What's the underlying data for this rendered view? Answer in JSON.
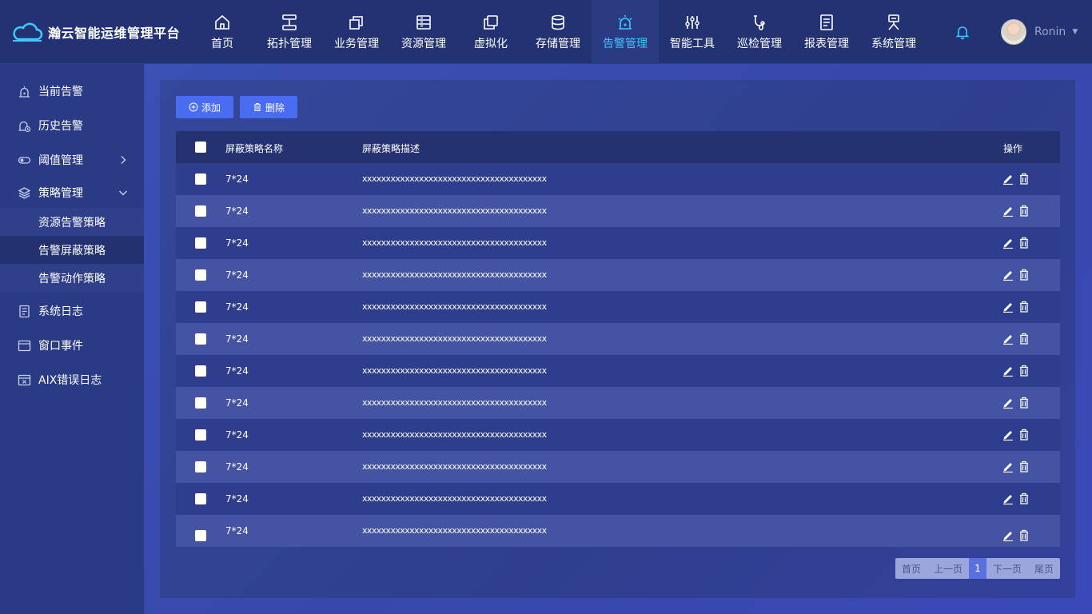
{
  "brand": {
    "name": "瀚云智能运维管理平台"
  },
  "nav": [
    {
      "label": "首页",
      "icon": "home-icon"
    },
    {
      "label": "拓扑管理",
      "icon": "topology-icon"
    },
    {
      "label": "业务管理",
      "icon": "business-icon"
    },
    {
      "label": "资源管理",
      "icon": "resource-icon"
    },
    {
      "label": "虚拟化",
      "icon": "virtualization-icon"
    },
    {
      "label": "存储管理",
      "icon": "storage-icon"
    },
    {
      "label": "告警管理",
      "icon": "alarm-icon",
      "active": true
    },
    {
      "label": "智能工具",
      "icon": "tools-icon"
    },
    {
      "label": "巡检管理",
      "icon": "inspection-icon"
    },
    {
      "label": "报表管理",
      "icon": "report-icon"
    },
    {
      "label": "系统管理",
      "icon": "system-icon"
    }
  ],
  "header": {
    "username": "Ronin",
    "accent": "#3ec8ff"
  },
  "sidebar": {
    "items": [
      {
        "label": "当前告警",
        "icon": "current-alarm-icon"
      },
      {
        "label": "历史告警",
        "icon": "history-alarm-icon"
      },
      {
        "label": "阈值管理",
        "icon": "threshold-icon"
      },
      {
        "label": "策略管理",
        "icon": "strategy-icon",
        "expanded": true
      },
      {
        "label": "系统日志",
        "icon": "system-log-icon"
      },
      {
        "label": "窗口事件",
        "icon": "window-event-icon"
      },
      {
        "label": "AIX错误日志",
        "icon": "aix-error-log-icon"
      }
    ],
    "submenu": [
      {
        "label": "资源告警策略"
      },
      {
        "label": "告警屏蔽策略",
        "active": true
      },
      {
        "label": "告警动作策略"
      }
    ]
  },
  "toolbar": {
    "add_label": "添加",
    "delete_label": "删除",
    "button_color": "#4a6cf0"
  },
  "table": {
    "headers": {
      "name": "屏蔽策略名称",
      "desc": "屏蔽策略描述",
      "op": "操作"
    },
    "rows": [
      {
        "name": "7*24",
        "desc": "xxxxxxxxxxxxxxxxxxxxxxxxxxxxxxxxxxxxxxx"
      },
      {
        "name": "7*24",
        "desc": "xxxxxxxxxxxxxxxxxxxxxxxxxxxxxxxxxxxxxxx"
      },
      {
        "name": "7*24",
        "desc": "xxxxxxxxxxxxxxxxxxxxxxxxxxxxxxxxxxxxxxx"
      },
      {
        "name": "7*24",
        "desc": "xxxxxxxxxxxxxxxxxxxxxxxxxxxxxxxxxxxxxxx"
      },
      {
        "name": "7*24",
        "desc": "xxxxxxxxxxxxxxxxxxxxxxxxxxxxxxxxxxxxxxx"
      },
      {
        "name": "7*24",
        "desc": "xxxxxxxxxxxxxxxxxxxxxxxxxxxxxxxxxxxxxxx"
      },
      {
        "name": "7*24",
        "desc": "xxxxxxxxxxxxxxxxxxxxxxxxxxxxxxxxxxxxxxx"
      },
      {
        "name": "7*24",
        "desc": "xxxxxxxxxxxxxxxxxxxxxxxxxxxxxxxxxxxxxxx"
      },
      {
        "name": "7*24",
        "desc": "xxxxxxxxxxxxxxxxxxxxxxxxxxxxxxxxxxxxxxx"
      },
      {
        "name": "7*24",
        "desc": "xxxxxxxxxxxxxxxxxxxxxxxxxxxxxxxxxxxxxxx"
      },
      {
        "name": "7*24",
        "desc": "xxxxxxxxxxxxxxxxxxxxxxxxxxxxxxxxxxxxxxx"
      },
      {
        "name": "7*24",
        "desc": "xxxxxxxxxxxxxxxxxxxxxxxxxxxxxxxxxxxxxxx"
      }
    ]
  },
  "pagination": {
    "first": "首页",
    "prev": "上一页",
    "current": "1",
    "next": "下一页",
    "last": "尾页"
  }
}
